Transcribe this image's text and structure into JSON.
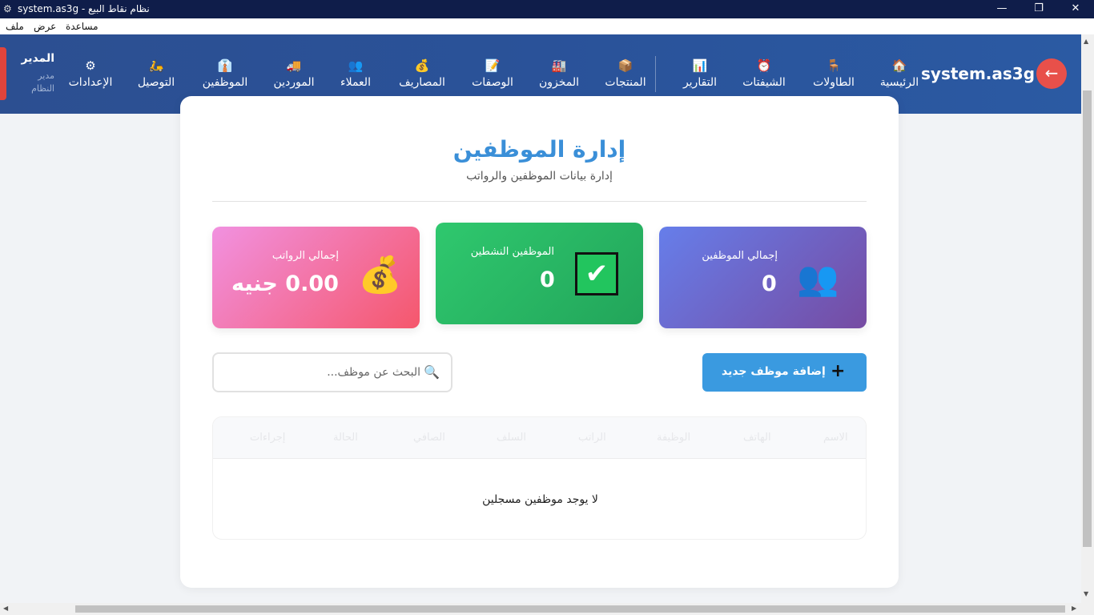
{
  "window": {
    "title": "نظام نقاط البيع - system.as3g",
    "minimize": "—",
    "maximize": "❐",
    "close": "✕"
  },
  "menubar": {
    "file": "ملف",
    "view": "عرض",
    "help": "مساعدة"
  },
  "header": {
    "brand": "system.as3g",
    "back_icon": "←",
    "user_name": "المدير",
    "user_role": "مدير النظام",
    "nav": [
      {
        "label": "الرئيسية",
        "icon": "🏠"
      },
      {
        "label": "الطاولات",
        "icon": "🪑"
      },
      {
        "label": "الشيفتات",
        "icon": "⏰"
      },
      {
        "label": "التقارير",
        "icon": "📊"
      },
      {
        "label": "المنتجات",
        "icon": "📦"
      },
      {
        "label": "المخزون",
        "icon": "🏭"
      },
      {
        "label": "الوصفات",
        "icon": "📝"
      },
      {
        "label": "المصاريف",
        "icon": "💰"
      },
      {
        "label": "العملاء",
        "icon": "👥"
      },
      {
        "label": "الموردين",
        "icon": "🚚"
      },
      {
        "label": "الموظفين",
        "icon": "👔"
      },
      {
        "label": "التوصيل",
        "icon": "🛵"
      },
      {
        "label": "الإعدادات",
        "icon": "⚙"
      }
    ]
  },
  "page": {
    "title": "إدارة الموظفين",
    "subtitle": "إدارة بيانات الموظفين والرواتب"
  },
  "stats": {
    "total": {
      "label": "إجمالي الموظفين",
      "value": "0",
      "icon": "👥"
    },
    "active": {
      "label": "الموظفين النشطين",
      "value": "0",
      "icon": "✔"
    },
    "salaries": {
      "label": "إجمالي الرواتب",
      "value": "0.00 جنيه",
      "icon": "💰"
    }
  },
  "actions": {
    "add_label": "إضافة موظف جديد",
    "add_icon": "+",
    "search_placeholder": "البحث عن موظف...",
    "search_icon": "🔍"
  },
  "table": {
    "columns": [
      "الاسم",
      "الهاتف",
      "الوظيفة",
      "الراتب",
      "السلف",
      "الصافي",
      "الحالة",
      "إجراءات"
    ],
    "empty_message": "لا يوجد موظفين مسجلين"
  },
  "colors": {
    "header": "#2a5299",
    "accent": "#3a8fd8",
    "total_card": "#6a5acd",
    "active_card": "#2fc86e",
    "salary_card": "#f5576c"
  }
}
